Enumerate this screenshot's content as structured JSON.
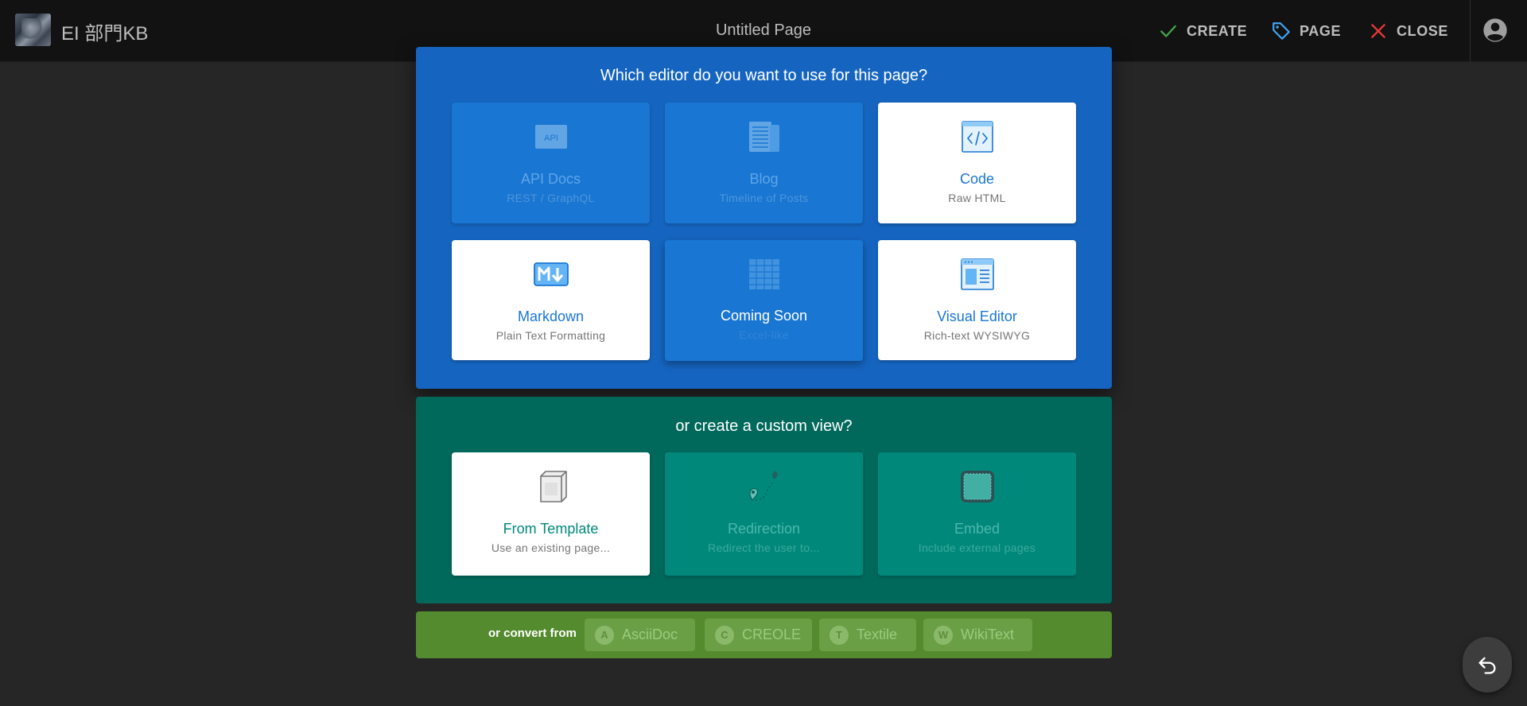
{
  "header": {
    "site_title": "EI 部門KB",
    "page_title": "Untitled Page",
    "actions": {
      "create": "CREATE",
      "page": "PAGE",
      "close": "CLOSE"
    }
  },
  "editor_dialog": {
    "question": "Which editor do you want to use for this page?",
    "editors": [
      {
        "title": "API Docs",
        "subtitle": "REST / GraphQL",
        "icon": "api-icon",
        "enabled": false
      },
      {
        "title": "Blog",
        "subtitle": "Timeline of Posts",
        "icon": "blog-icon",
        "enabled": false
      },
      {
        "title": "Code",
        "subtitle": "Raw HTML",
        "icon": "code-icon",
        "enabled": true
      },
      {
        "title": "Markdown",
        "subtitle": "Plain Text Formatting",
        "icon": "markdown-icon",
        "enabled": true
      },
      {
        "title": "Coming Soon",
        "subtitle": "Excel-like",
        "icon": "spreadsheet-icon",
        "enabled": false
      },
      {
        "title": "Visual Editor",
        "subtitle": "Rich-text WYSIWYG",
        "icon": "visual-editor-icon",
        "enabled": true
      }
    ]
  },
  "custom_view": {
    "question": "or create a custom view?",
    "options": [
      {
        "title": "From Template",
        "subtitle": "Use an existing page...",
        "icon": "template-box-icon",
        "enabled": true
      },
      {
        "title": "Redirection",
        "subtitle": "Redirect the user to...",
        "icon": "redirection-icon",
        "enabled": false
      },
      {
        "title": "Embed",
        "subtitle": "Include external pages",
        "icon": "embed-icon",
        "enabled": false
      }
    ]
  },
  "convert": {
    "label": "or convert from",
    "formats": [
      {
        "badge": "A",
        "label": "AsciiDoc"
      },
      {
        "badge": "C",
        "label": "CREOLE"
      },
      {
        "badge": "T",
        "label": "Textile"
      },
      {
        "badge": "W",
        "label": "WikiText"
      }
    ]
  },
  "colors": {
    "editor_panel": "#1565c0",
    "custom_panel": "#00695c",
    "convert_panel": "#558b2f",
    "topbar": "#121212",
    "background": "#262626"
  }
}
